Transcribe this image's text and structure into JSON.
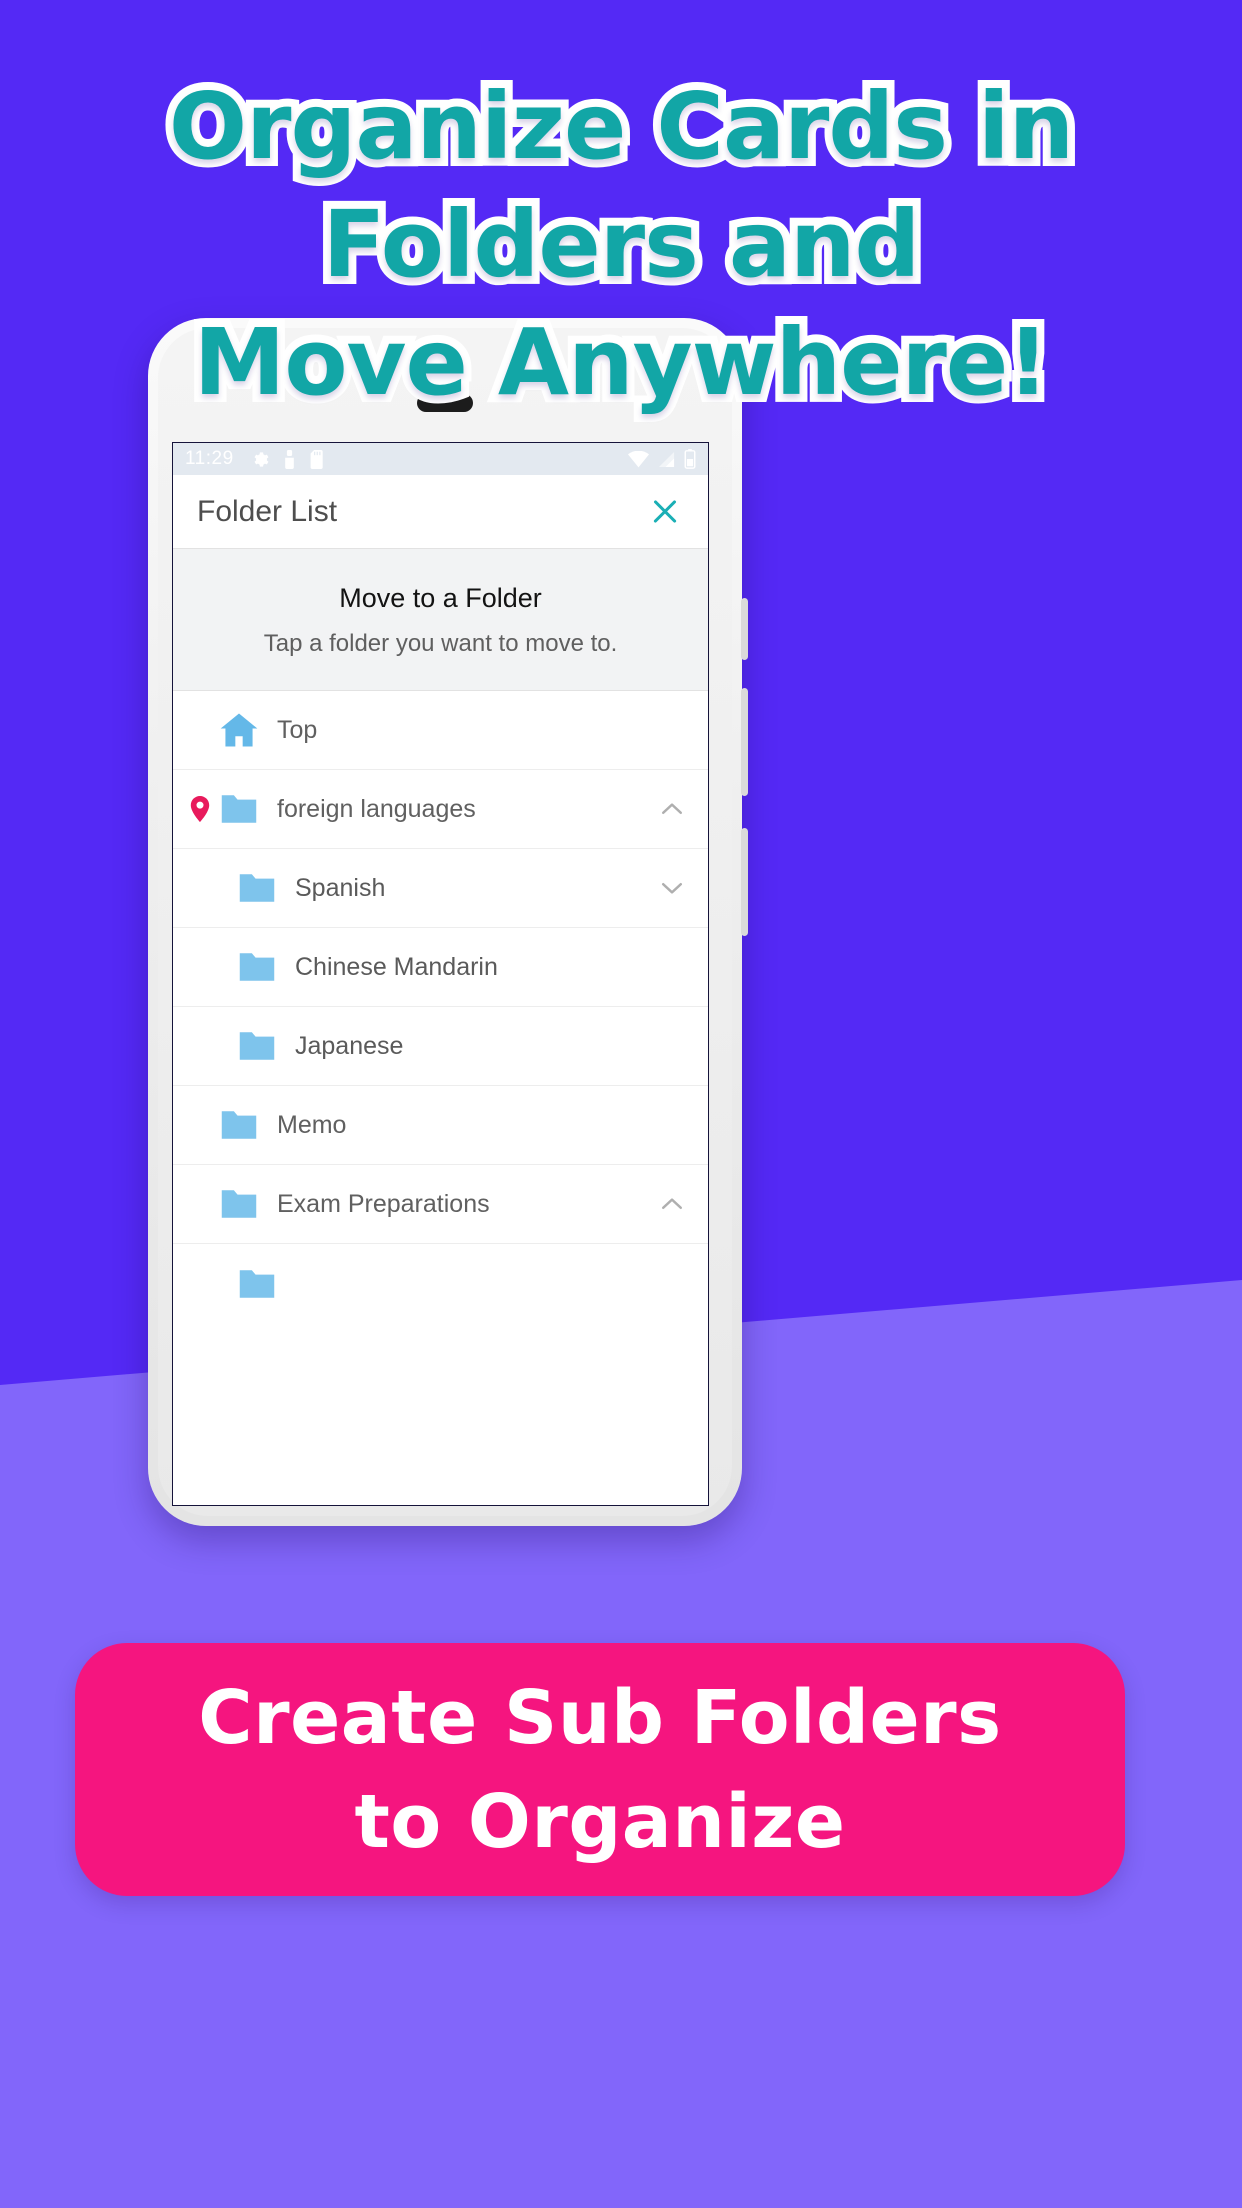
{
  "theme": {
    "bg_purple": "#5429F5",
    "bg_purple_light": "#8266FA",
    "headline_teal": "#12A6A6",
    "headline_outline": "#FFFFFF",
    "banner_pink": "#F5157F",
    "folder_blue": "#7EC4EC",
    "home_blue": "#64B8E8",
    "pin_pink": "#E81A5C",
    "close_teal": "#1AAFB5"
  },
  "headline": {
    "lines": [
      "Organize Cards in",
      "Folders and",
      "Move Anywhere!"
    ]
  },
  "phone": {
    "status_bar": {
      "clock": "11:29",
      "left_icons": [
        "gear-icon",
        "sim-icon",
        "sd-card-icon"
      ],
      "right_icons": [
        "wifi-icon",
        "signal-icon",
        "battery-icon"
      ]
    },
    "app_bar": {
      "title": "Folder List",
      "close_icon": "close-icon"
    },
    "prompt": {
      "title": "Move to a Folder",
      "subtitle": "Tap a folder you want to move to."
    },
    "folders": [
      {
        "label": "Top",
        "icon": "home-icon",
        "indent": 0,
        "pinned": false,
        "chevron": "none"
      },
      {
        "label": "foreign languages",
        "icon": "folder-icon",
        "indent": 0,
        "pinned": true,
        "chevron": "chevron-up-icon"
      },
      {
        "label": "Spanish",
        "icon": "folder-icon",
        "indent": 1,
        "pinned": false,
        "chevron": "chevron-down-icon"
      },
      {
        "label": "Chinese Mandarin",
        "icon": "folder-icon",
        "indent": 1,
        "pinned": false,
        "chevron": "none"
      },
      {
        "label": "Japanese",
        "icon": "folder-icon",
        "indent": 1,
        "pinned": false,
        "chevron": "none"
      },
      {
        "label": "Memo",
        "icon": "folder-icon",
        "indent": 0,
        "pinned": false,
        "chevron": "none"
      },
      {
        "label": "Exam Preparations",
        "icon": "folder-icon",
        "indent": 0,
        "pinned": false,
        "chevron": "chevron-up-icon"
      }
    ]
  },
  "banner": {
    "lines": [
      "Create Sub Folders",
      "to Organize"
    ]
  }
}
